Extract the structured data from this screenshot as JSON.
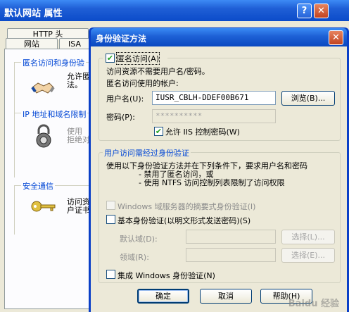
{
  "background_window": {
    "title": "默认网站 属性",
    "help_glyph": "?",
    "close_glyph": "✕",
    "tabs_row1": [
      "HTTP 头"
    ],
    "tabs_row2": [
      "网站",
      "ISA"
    ],
    "sections": [
      {
        "label": "匿名访问和身份验",
        "text_lines": [
          "允许匿",
          "法。"
        ],
        "icon": "handshake-icon"
      },
      {
        "label": "IP 地址和域名限制",
        "text_lines": [
          "使用",
          "拒绝对"
        ],
        "icon": "padlock-icon"
      },
      {
        "label": "安全通信",
        "text_lines": [
          "访问资",
          "户证书"
        ],
        "icon": "key-icon"
      }
    ]
  },
  "dialog": {
    "title": "身份验证方法",
    "close_glyph": "✕",
    "anonymous": {
      "checkbox_label": "匿名访问(A)",
      "checked": true,
      "desc": "访问资源不需要用户名/密码。",
      "account_caption": "匿名访问使用的帐户:",
      "username_label": "用户名(U):",
      "username_value": "IUSR_CBLH-DDEF00B671",
      "browse_label": "浏览(B)...",
      "password_label": "密码(P):",
      "password_value": "**********",
      "iis_checkbox_label": "允许 IIS 控制密码(W)",
      "iis_checked": true
    },
    "authenticated": {
      "group_label": "用户访问需经过身份验证",
      "desc_lines": [
        "使用以下身份验证方法并在下列条件下，要求用户名和密码",
        "- 禁用了匿名访问，或",
        "- 使用 NTFS 访问控制列表限制了访问权限"
      ],
      "digest_label": "Windows 域服务器的摘要式身份验证(I)",
      "basic_label": "基本身份验证(以明文形式发送密码)(S)",
      "default_domain_label": "默认域(D):",
      "realm_label": "领域(R):",
      "select_label": "选择(L)...",
      "select_label2": "选择(E)...",
      "integrated_label": "集成 Windows 身份验证(N)"
    },
    "buttons": {
      "ok": "确定",
      "cancel": "取消",
      "help": "帮助(H)"
    }
  },
  "watermark": "Baidu 经验"
}
